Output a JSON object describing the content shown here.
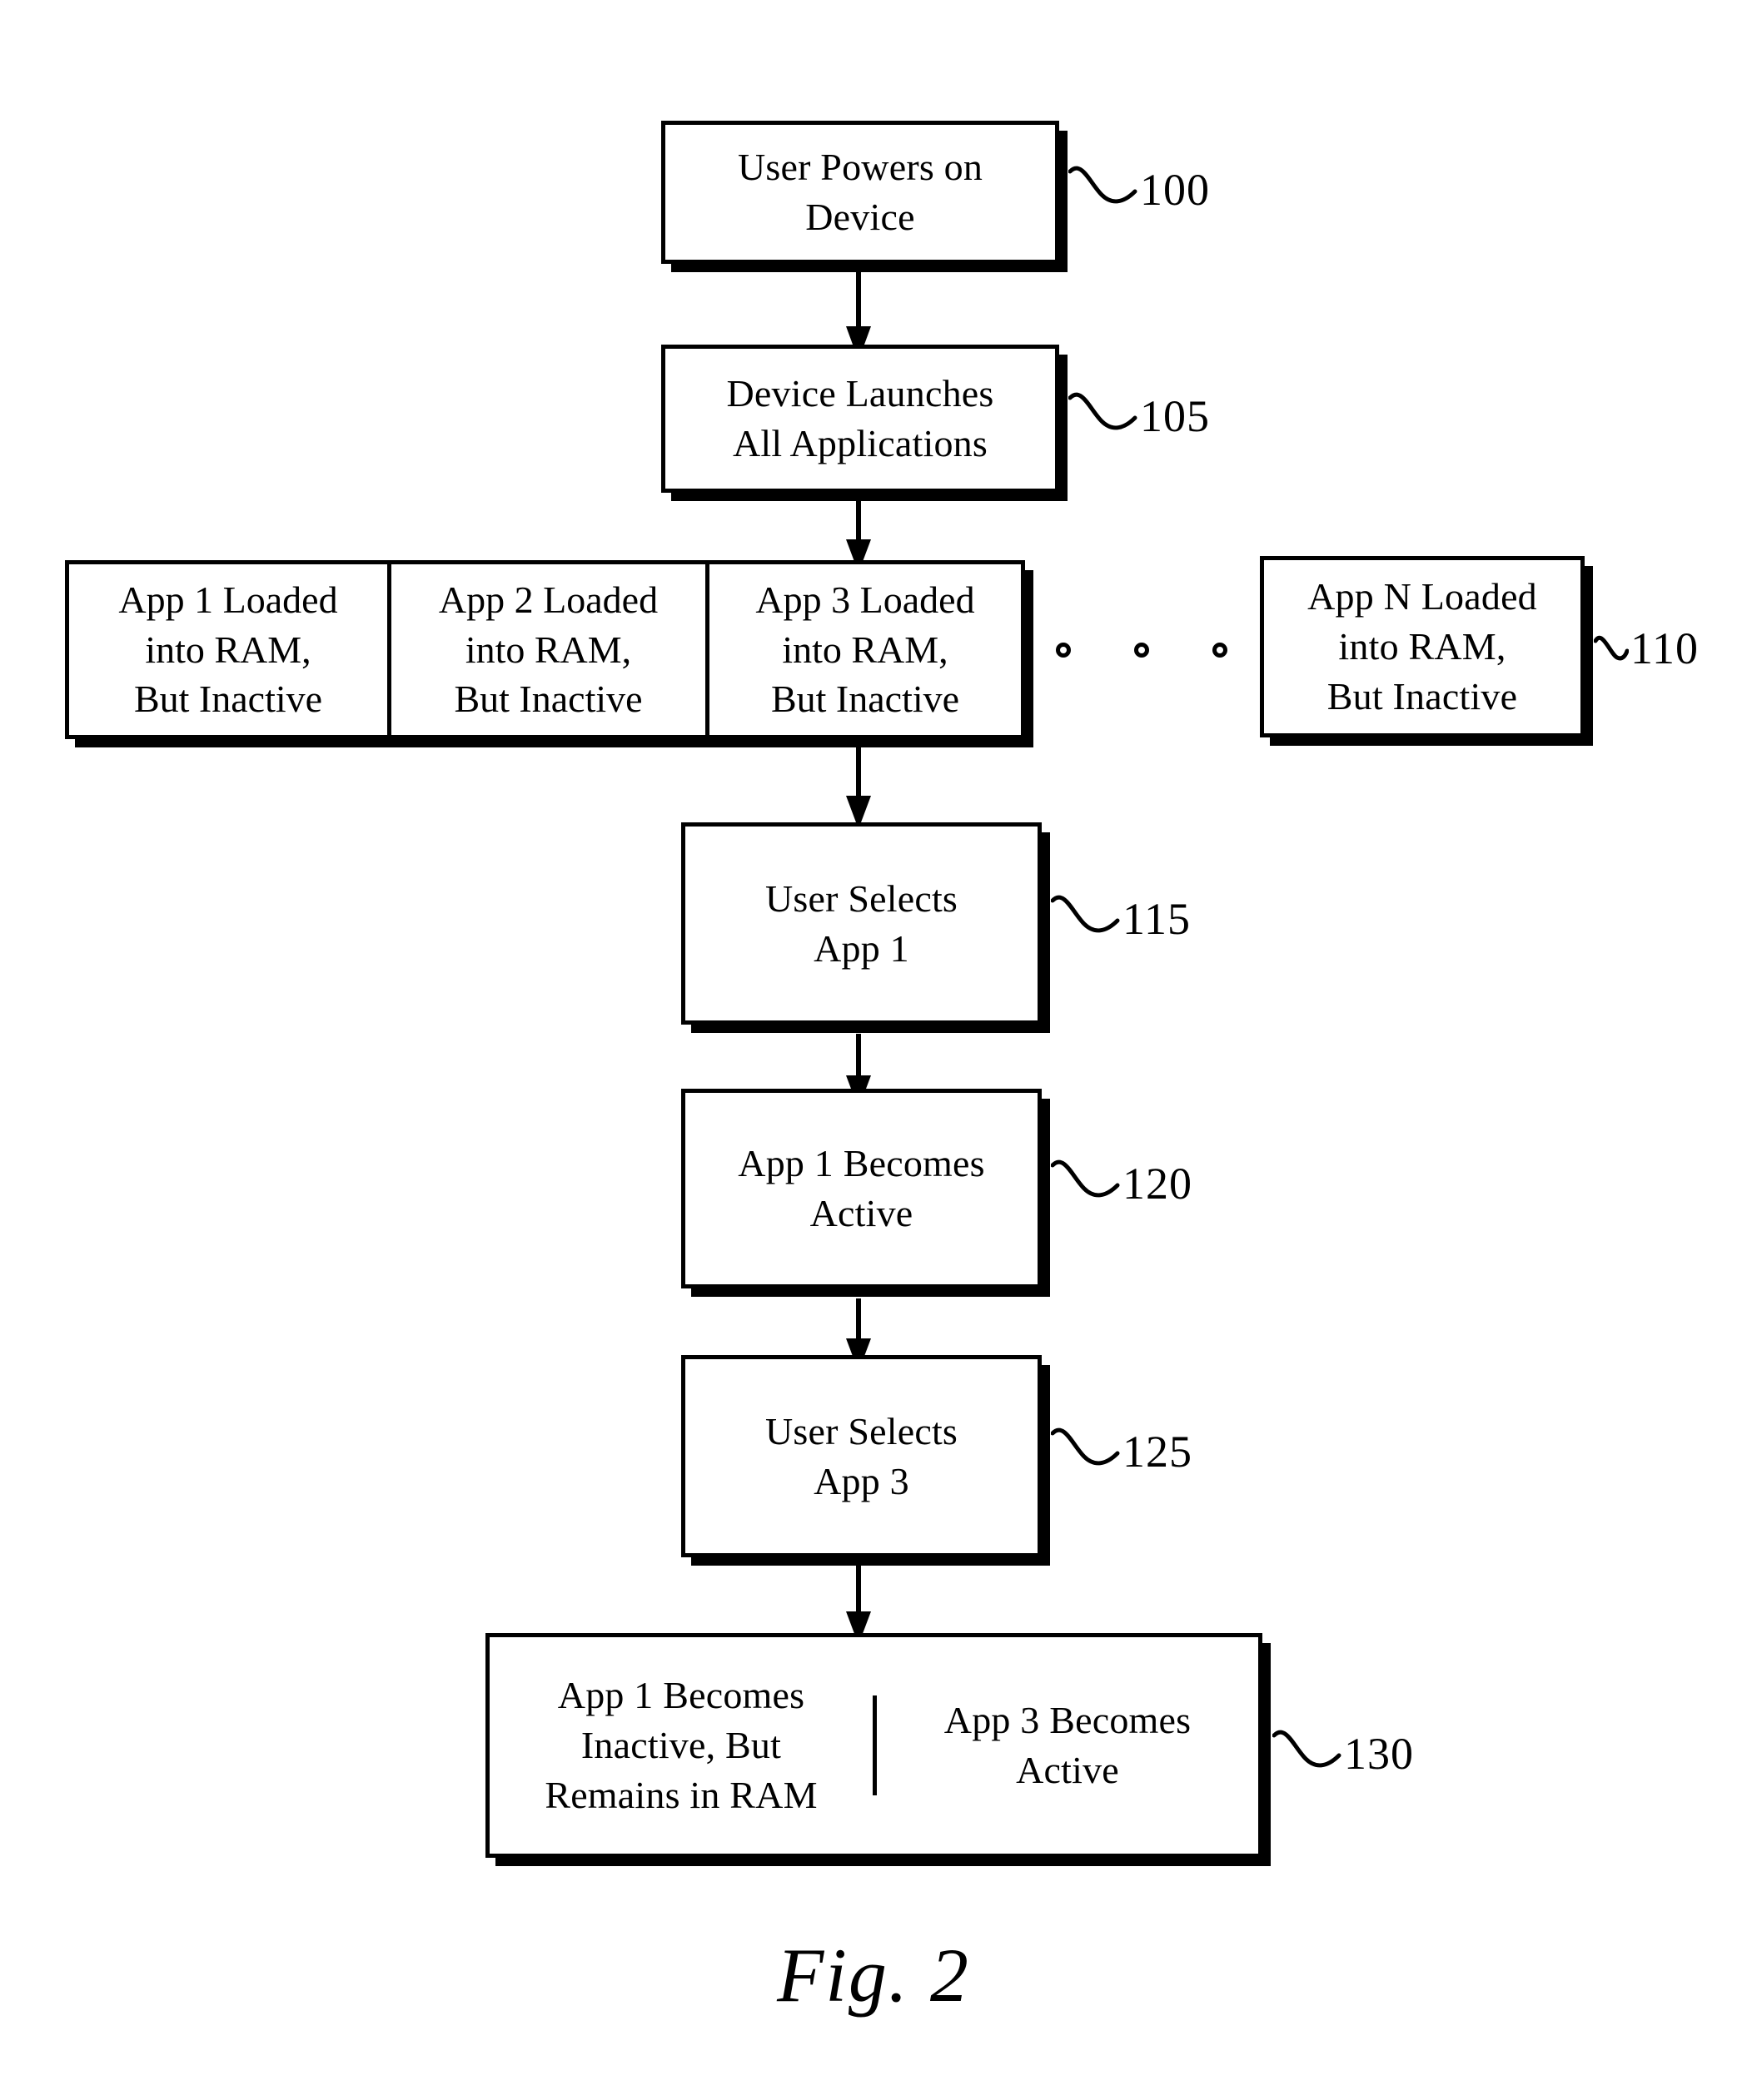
{
  "figure": {
    "caption": "Fig. 2",
    "type": "flowchart"
  },
  "nodes": [
    {
      "id": "100",
      "ref": "100",
      "text": "User Powers on\nDevice"
    },
    {
      "id": "105",
      "ref": "105",
      "text": "Device Launches\nAll Applications"
    },
    {
      "id": "115",
      "ref": "115",
      "text": "User Selects\nApp 1"
    },
    {
      "id": "120",
      "ref": "120",
      "text": "App 1 Becomes\nActive"
    },
    {
      "id": "125",
      "ref": "125",
      "text": "User Selects\nApp 3"
    }
  ],
  "app_row": {
    "ref": "110",
    "cells": [
      {
        "text": "App 1 Loaded\ninto RAM,\nBut Inactive"
      },
      {
        "text": "App 2 Loaded\ninto RAM,\nBut Inactive"
      },
      {
        "text": "App 3 Loaded\ninto RAM,\nBut Inactive"
      }
    ],
    "ellipsis": "o   o   o",
    "tail_cell": {
      "text": "App N Loaded\ninto RAM,\nBut Inactive"
    }
  },
  "final_node": {
    "ref": "130",
    "left": "App 1 Becomes\nInactive, But\nRemains in RAM",
    "right": "App 3 Becomes\nActive"
  },
  "colors": {
    "ink": "#000000",
    "paper": "#ffffff"
  }
}
